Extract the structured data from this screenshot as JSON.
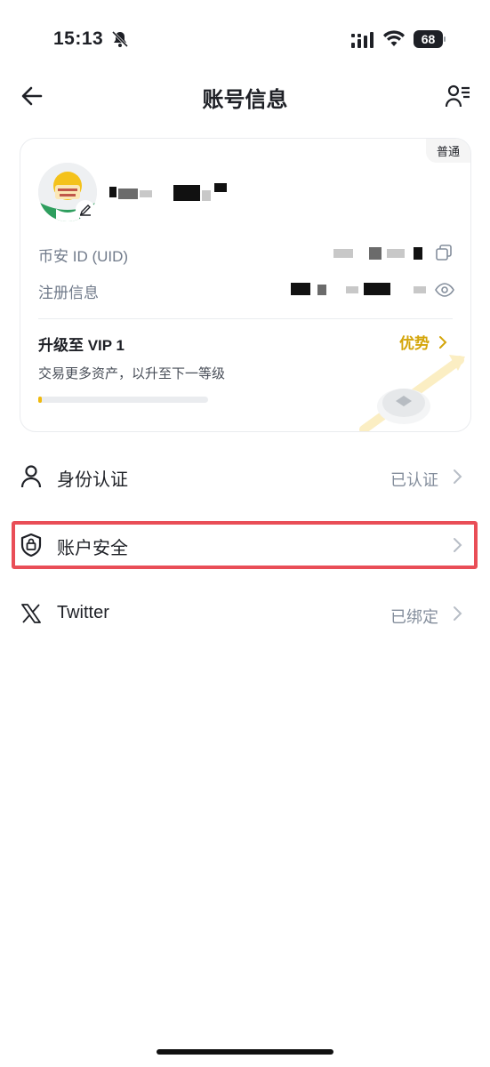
{
  "status_bar": {
    "time": "15:13",
    "battery_percent": "68",
    "icons": [
      "bell-off-icon",
      "signal-icon",
      "wifi-icon",
      "battery-icon"
    ]
  },
  "header": {
    "title": "账号信息",
    "back_icon": "arrow-left-icon",
    "menu_icon": "profile-list-icon"
  },
  "account_card": {
    "tier_badge": "普通",
    "uid_label": "币安 ID (UID)",
    "registration_label": "注册信息",
    "vip": {
      "title": "升级至 VIP 1",
      "benefits_link": "优势",
      "subtitle": "交易更多资产，以升至下一等级",
      "progress": 0.02
    }
  },
  "menu": {
    "items": [
      {
        "label": "身份认证",
        "value": "已认证",
        "icon": "person-icon"
      },
      {
        "label": "账户安全",
        "value": "",
        "icon": "shield-lock-icon"
      },
      {
        "label": "Twitter",
        "value": "已绑定",
        "icon": "x-logo-icon"
      }
    ]
  },
  "colors": {
    "accent": "#F0B90B",
    "highlight_border": "#E94E57",
    "text_primary": "#1E2026",
    "text_secondary": "#848E9C"
  }
}
